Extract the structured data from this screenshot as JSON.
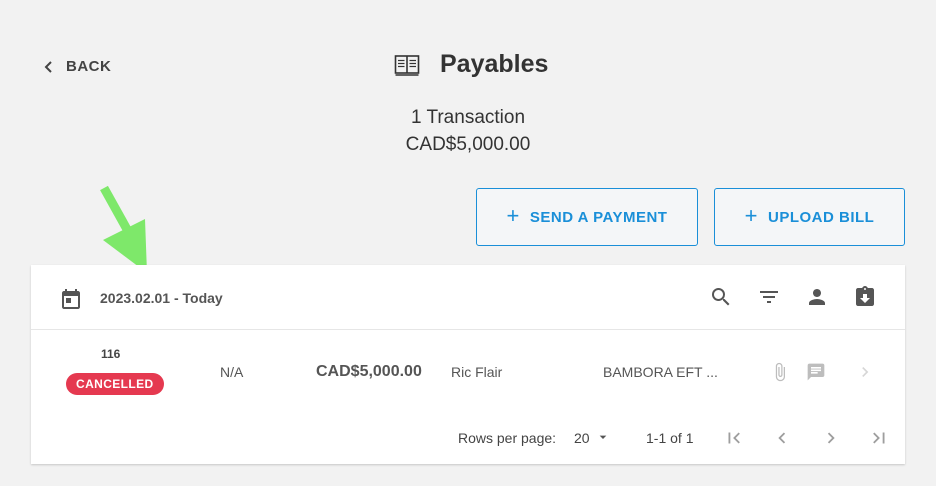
{
  "header": {
    "back_label": "BACK",
    "title": "Payables",
    "transaction_count": "1 Transaction",
    "total": "CAD$5,000.00"
  },
  "actions": {
    "send_payment_label": "SEND A PAYMENT",
    "upload_bill_label": "UPLOAD BILL"
  },
  "colors": {
    "accent": "#1a8fd8",
    "cancelled": "#e53950",
    "annotation_arrow": "#7ee86a"
  },
  "toolbar": {
    "date_range": "2023.02.01 - Today",
    "icons": [
      "calendar-icon",
      "search-icon",
      "filter-icon",
      "person-icon",
      "assignment-returned-icon"
    ]
  },
  "rows": [
    {
      "number": "116",
      "status": "CANCELLED",
      "reference": "N/A",
      "amount": "CAD$5,000.00",
      "vendor": "Ric Flair",
      "method": "BAMBORA EFT ...",
      "icons": [
        "attachment-icon",
        "comment-icon",
        "chevron-right-icon"
      ]
    }
  ],
  "pagination": {
    "rows_per_page_label": "Rows per page:",
    "rows_per_page": "20",
    "range": "1-1 of 1"
  }
}
